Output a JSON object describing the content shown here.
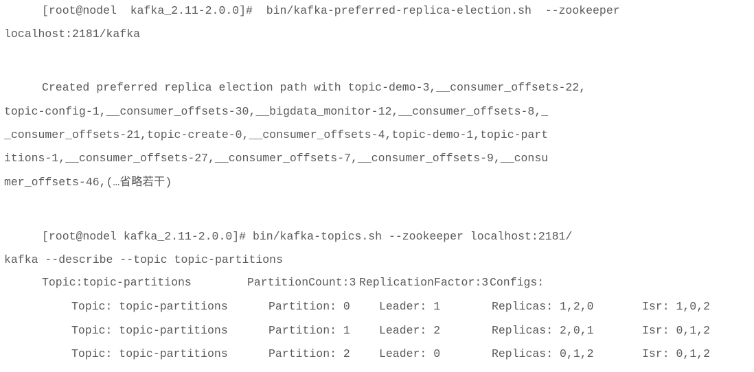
{
  "block1": {
    "line1": "[root@nodel  kafka_2.11-2.0.0]#  bin/kafka-preferred-replica-election.sh  --zookeeper",
    "line2": "localhost:2181/kafka"
  },
  "block2": {
    "line1": "Created preferred replica election path with topic-demo-3,__consumer_offsets-22,",
    "line2": "topic-config-1,__consumer_offsets-30,__bigdata_monitor-12,__consumer_offsets-8,_",
    "line3": "_consumer_offsets-21,topic-create-0,__consumer_offsets-4,topic-demo-1,topic-part",
    "line4": "itions-1,__consumer_offsets-27,__consumer_offsets-7,__consumer_offsets-9,__consu",
    "line5": "mer_offsets-46,(…省略若干)"
  },
  "block3": {
    "line1": "[root@nodel kafka_2.11-2.0.0]# bin/kafka-topics.sh --zookeeper localhost:2181/",
    "line2": "kafka --describe --topic topic-partitions",
    "summary": {
      "topic": "Topic:topic-partitions",
      "partition_count": "PartitionCount:3",
      "replication_factor": "ReplicationFactor:3",
      "configs": "Configs:"
    },
    "rows": [
      {
        "topic": "Topic: topic-partitions",
        "partition": "Partition: 0",
        "leader": "Leader: 1",
        "replicas": "Replicas: 1,2,0",
        "isr": "Isr: 1,0,2"
      },
      {
        "topic": "Topic: topic-partitions",
        "partition": "Partition: 1",
        "leader": "Leader: 2",
        "replicas": "Replicas: 2,0,1",
        "isr": "Isr: 0,1,2"
      },
      {
        "topic": "Topic: topic-partitions",
        "partition": "Partition: 2",
        "leader": "Leader: 0",
        "replicas": "Replicas: 0,1,2",
        "isr": "Isr: 0,1,2"
      }
    ]
  }
}
